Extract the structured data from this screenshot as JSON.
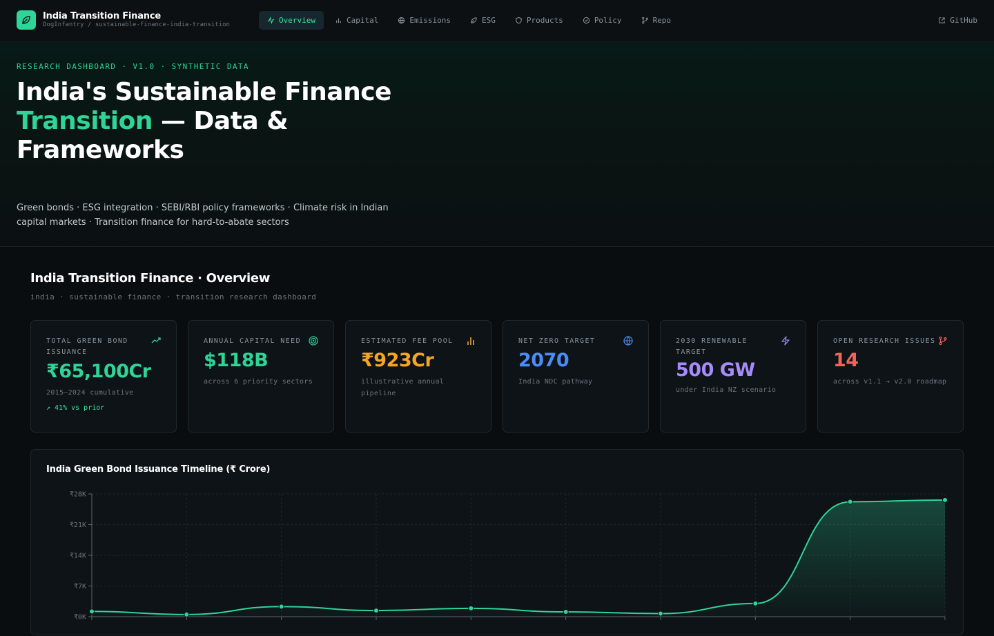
{
  "brand": {
    "title": "India Transition Finance",
    "subtitle": "DogInfantry / sustainable-finance-india-transition"
  },
  "nav": {
    "items": [
      {
        "label": "Overview",
        "icon": "pulse-icon",
        "active": true
      },
      {
        "label": "Capital",
        "icon": "bar-chart-icon",
        "active": false
      },
      {
        "label": "Emissions",
        "icon": "globe-icon",
        "active": false
      },
      {
        "label": "ESG",
        "icon": "leaf-icon",
        "active": false
      },
      {
        "label": "Products",
        "icon": "shield-icon",
        "active": false
      },
      {
        "label": "Policy",
        "icon": "check-circle-icon",
        "active": false
      },
      {
        "label": "Repo",
        "icon": "git-branch-icon",
        "active": false
      }
    ],
    "github_label": "GitHub"
  },
  "hero": {
    "eyebrow": "RESEARCH DASHBOARD · V1.0 · SYNTHETIC DATA",
    "title_part1": "India's Sustainable Finance",
    "title_accent": "Transition",
    "title_part2": " — Data & Frameworks",
    "description": "Green bonds · ESG integration · SEBI/RBI policy frameworks · Climate risk in Indian capital markets · Transition finance for hard-to-abate sectors"
  },
  "overview": {
    "title": "India Transition Finance · Overview",
    "subtitle": "india · sustainable finance · transition research dashboard"
  },
  "cards": [
    {
      "label": "TOTAL GREEN BOND ISSUANCE",
      "value": "₹65,100Cr",
      "note": "2015–2024 cumulative",
      "delta": "↗ 41% vs prior",
      "color": "#2fd497",
      "icon": "trend-up-icon"
    },
    {
      "label": "ANNUAL CAPITAL NEED",
      "value": "$118B",
      "note": "across 6 priority sectors",
      "delta": "",
      "color": "#2fd497",
      "icon": "target-icon"
    },
    {
      "label": "ESTIMATED FEE POOL",
      "value": "₹923Cr",
      "note": "illustrative annual pipeline",
      "delta": "",
      "color": "#f5a524",
      "icon": "bar-chart-icon"
    },
    {
      "label": "NET ZERO TARGET",
      "value": "2070",
      "note": "India NDC pathway",
      "delta": "",
      "color": "#4b8df8",
      "icon": "globe-icon"
    },
    {
      "label": "2030 RENEWABLE TARGET",
      "value": "500 GW",
      "note": "under India NZ scenario",
      "delta": "",
      "color": "#a78bfa",
      "icon": "bolt-icon"
    },
    {
      "label": "OPEN RESEARCH ISSUES",
      "value": "14",
      "note": "across v1.1 → v2.0 roadmap",
      "delta": "",
      "color": "#f0655a",
      "icon": "git-branch-icon"
    }
  ],
  "chart_data": {
    "type": "area",
    "title": "India Green Bond Issuance Timeline (₹ Crore)",
    "y_ticks": [
      "₹28K",
      "₹21K",
      "₹14K",
      "₹7K",
      "₹0K"
    ],
    "ylim": [
      0,
      28000
    ],
    "values": [
      1200,
      500,
      2300,
      1400,
      1900,
      1100,
      700,
      3000,
      26200,
      26600
    ],
    "grid": true,
    "color": "#2fd497"
  }
}
